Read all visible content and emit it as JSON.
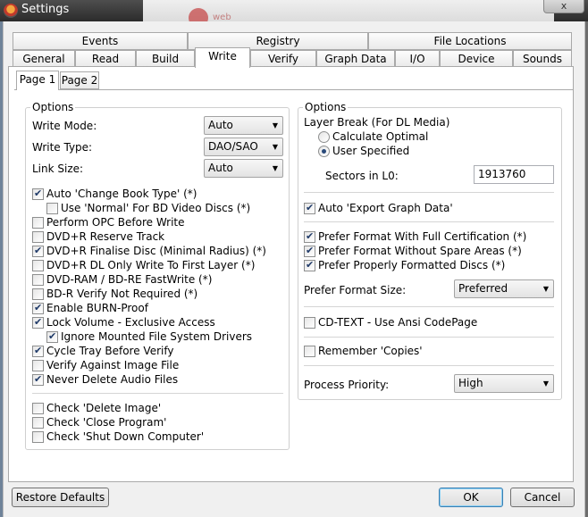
{
  "window": {
    "title": "Settings",
    "close_label": "x"
  },
  "tabs_row1": [
    {
      "label": "Events"
    },
    {
      "label": "Registry"
    },
    {
      "label": "File Locations"
    }
  ],
  "tabs_row2": [
    {
      "label": "General"
    },
    {
      "label": "Read"
    },
    {
      "label": "Build"
    },
    {
      "label": "Write"
    },
    {
      "label": "Verify"
    },
    {
      "label": "Graph Data"
    },
    {
      "label": "I/O"
    },
    {
      "label": "Device"
    },
    {
      "label": "Sounds"
    }
  ],
  "subtabs": [
    {
      "label": "Page 1"
    },
    {
      "label": "Page 2"
    }
  ],
  "left": {
    "group_title": "Options",
    "write_mode": {
      "label": "Write Mode:",
      "value": "Auto"
    },
    "write_type": {
      "label": "Write Type:",
      "value": "DAO/SAO"
    },
    "link_size": {
      "label": "Link Size:",
      "value": "Auto"
    },
    "checkboxes": [
      {
        "label": "Auto 'Change Book Type' (*)",
        "checked": true
      },
      {
        "label": "Use 'Normal' For BD Video Discs (*)",
        "checked": false
      },
      {
        "label": "Perform OPC Before Write",
        "checked": false
      },
      {
        "label": "DVD+R Reserve Track",
        "checked": false
      },
      {
        "label": "DVD+R Finalise Disc (Minimal Radius) (*)",
        "checked": true
      },
      {
        "label": "DVD+R DL Only Write To First Layer (*)",
        "checked": false
      },
      {
        "label": "DVD-RAM / BD-RE FastWrite (*)",
        "checked": false
      },
      {
        "label": "BD-R Verify Not Required (*)",
        "checked": false
      },
      {
        "label": "Enable BURN-Proof",
        "checked": true
      },
      {
        "label": "Lock Volume - Exclusive Access",
        "checked": true
      },
      {
        "label": "Ignore Mounted File System Drivers",
        "checked": true
      },
      {
        "label": "Cycle Tray Before Verify",
        "checked": true
      },
      {
        "label": "Verify Against Image File",
        "checked": false
      },
      {
        "label": "Never Delete Audio Files",
        "checked": true
      }
    ],
    "check_items": [
      {
        "label": "Check 'Delete Image'",
        "checked": false
      },
      {
        "label": "Check 'Close Program'",
        "checked": false
      },
      {
        "label": "Check 'Shut Down Computer'",
        "checked": false
      }
    ]
  },
  "right": {
    "group_title": "Options",
    "layer_break_label": "Layer Break (For DL Media)",
    "radio_calculate": {
      "label": "Calculate Optimal",
      "selected": false
    },
    "radio_user": {
      "label": "User Specified",
      "selected": true
    },
    "sectors_label": "Sectors in L0:",
    "sectors_value": "1913760",
    "auto_export": {
      "label": "Auto 'Export Graph Data'",
      "checked": true
    },
    "prefer_full_cert": {
      "label": "Prefer Format With Full Certification (*)",
      "checked": true
    },
    "prefer_no_spare": {
      "label": "Prefer Format Without Spare Areas (*)",
      "checked": true
    },
    "prefer_properly": {
      "label": "Prefer Properly Formatted Discs (*)",
      "checked": true
    },
    "prefer_format_size": {
      "label": "Prefer Format Size:",
      "value": "Preferred"
    },
    "cd_text": {
      "label": "CD-TEXT - Use Ansi CodePage",
      "checked": false
    },
    "remember_copies": {
      "label": "Remember 'Copies'",
      "checked": false
    },
    "process_priority": {
      "label": "Process Priority:",
      "value": "High"
    }
  },
  "footer": {
    "restore_defaults": "Restore Defaults",
    "ok": "OK",
    "cancel": "Cancel"
  }
}
